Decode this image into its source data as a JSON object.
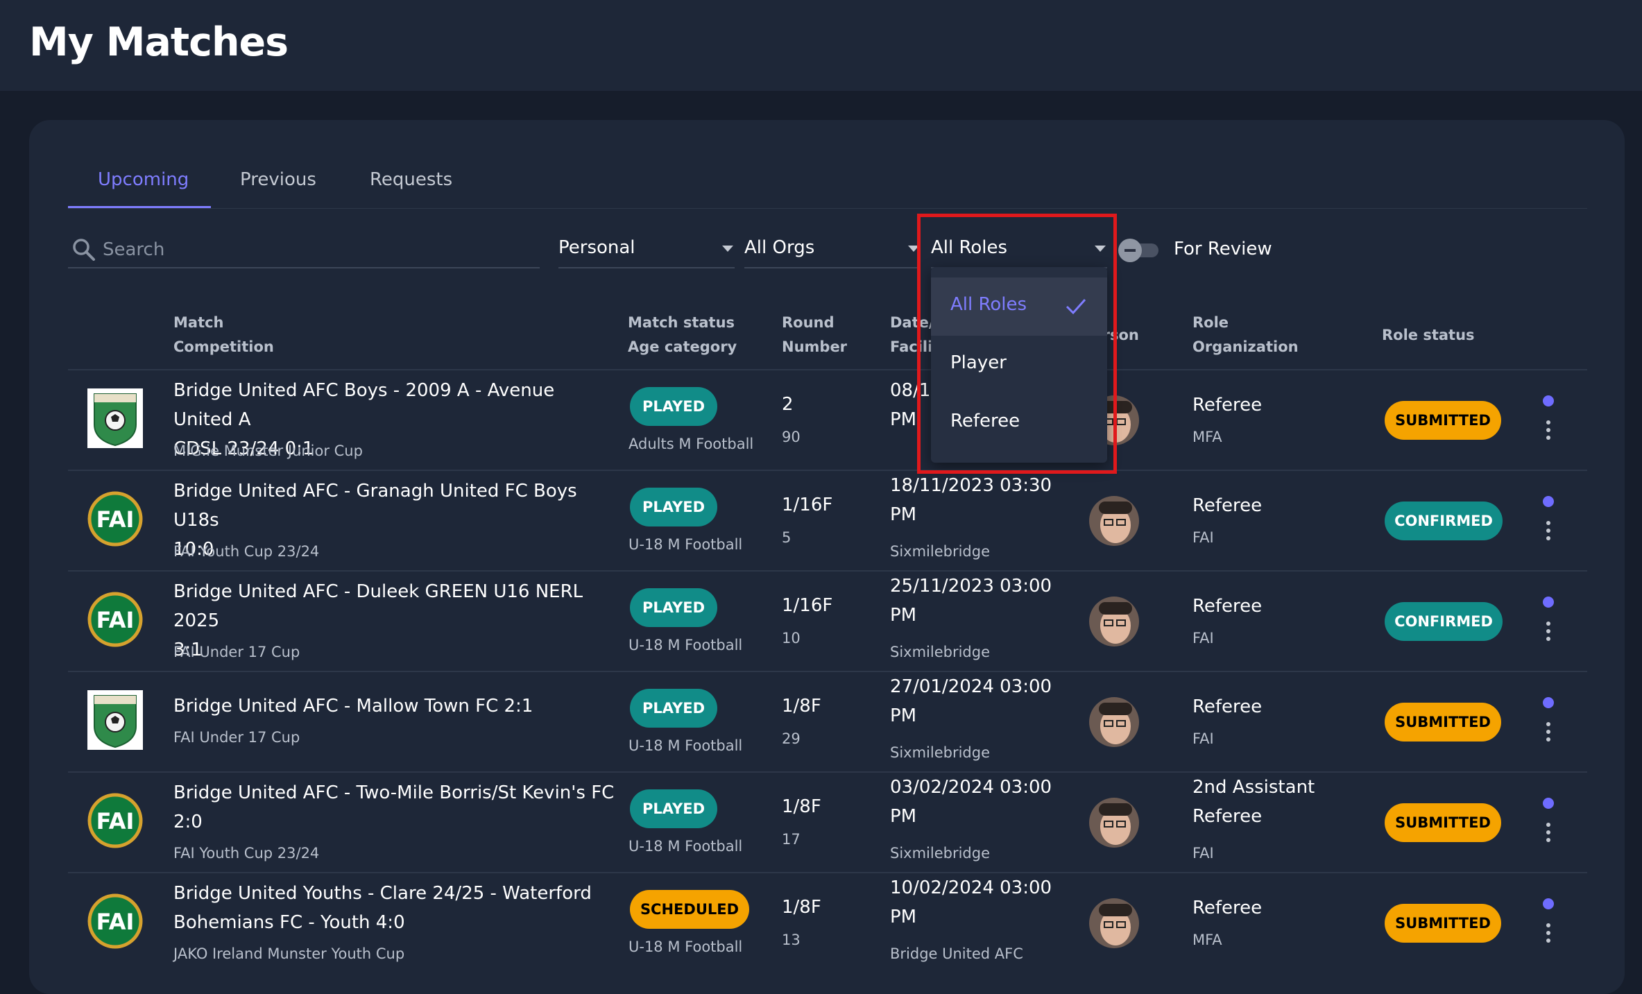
{
  "page": {
    "title": "My Matches"
  },
  "tabs": [
    {
      "label": "Upcoming",
      "active": true
    },
    {
      "label": "Previous",
      "active": false
    },
    {
      "label": "Requests",
      "active": false
    }
  ],
  "filters": {
    "search_placeholder": "Search",
    "scope": "Personal",
    "orgs": "All Orgs",
    "roles": "All Roles",
    "for_review_label": "For Review",
    "for_review_on": false
  },
  "dropdown": {
    "options": [
      {
        "label": "All Roles",
        "selected": true
      },
      {
        "label": "Player",
        "selected": false
      },
      {
        "label": "Referee",
        "selected": false
      }
    ]
  },
  "columns": {
    "match": "Match",
    "competition": "Competition",
    "match_status": "Match status",
    "age_category": "Age category",
    "round": "Round",
    "number": "Number",
    "date": "Date/",
    "facility": "Facility",
    "person": "Person",
    "role": "Role",
    "organization": "Organization",
    "role_status": "Role status"
  },
  "rows": [
    {
      "title_line1": "Bridge United AFC Boys - 2009 A - Avenue United A",
      "title_line2": "CDSL 23/24 0:1",
      "competition": "MIG.ie Munster Junior Cup",
      "status": "PLAYED",
      "age": "Adults M Football",
      "round": "2",
      "number": "90",
      "date_line1": "08/1",
      "date_line2": "PM",
      "facility": "",
      "role_line1": "Referee",
      "role_line2": "",
      "org": "MFA",
      "role_status": "SUBMITTED",
      "logo": "crest-logo"
    },
    {
      "title_line1": "Bridge United AFC - Granagh United FC Boys U18s",
      "title_line2": "10:0",
      "competition": "FAI Youth Cup 23/24",
      "status": "PLAYED",
      "age": "U-18 M Football",
      "round": "1/16F",
      "number": "5",
      "date_line1": "18/11/2023 03:30",
      "date_line2": "PM",
      "facility": "Sixmilebridge",
      "role_line1": "Referee",
      "role_line2": "",
      "org": "FAI",
      "role_status": "CONFIRMED",
      "logo": "fai-logo"
    },
    {
      "title_line1": "Bridge United AFC - Duleek GREEN U16 NERL 2025",
      "title_line2": "3:1",
      "competition": "FAI Under 17 Cup",
      "status": "PLAYED",
      "age": "U-18 M Football",
      "round": "1/16F",
      "number": "10",
      "date_line1": "25/11/2023 03:00",
      "date_line2": "PM",
      "facility": "Sixmilebridge",
      "role_line1": "Referee",
      "role_line2": "",
      "org": "FAI",
      "role_status": "CONFIRMED",
      "logo": "fai-logo"
    },
    {
      "title_line1": "Bridge United AFC - Mallow Town FC 2:1",
      "title_line2": "",
      "competition": "FAI Under 17 Cup",
      "status": "PLAYED",
      "age": "U-18 M Football",
      "round": "1/8F",
      "number": "29",
      "date_line1": "27/01/2024 03:00",
      "date_line2": "PM",
      "facility": "Sixmilebridge",
      "role_line1": "Referee",
      "role_line2": "",
      "org": "FAI",
      "role_status": "SUBMITTED",
      "logo": "crest-logo"
    },
    {
      "title_line1": "Bridge United AFC - Two-Mile Borris/St Kevin's FC",
      "title_line2": "2:0",
      "competition": "FAI Youth Cup 23/24",
      "status": "PLAYED",
      "age": "U-18 M Football",
      "round": "1/8F",
      "number": "17",
      "date_line1": "03/02/2024 03:00",
      "date_line2": "PM",
      "facility": "Sixmilebridge",
      "role_line1": "2nd Assistant",
      "role_line2": "Referee",
      "org": "FAI",
      "role_status": "SUBMITTED",
      "logo": "fai-logo"
    },
    {
      "title_line1": "Bridge United Youths - Clare 24/25 - Waterford",
      "title_line2": "Bohemians FC - Youth 4:0",
      "competition": "JAKO Ireland Munster Youth Cup",
      "status": "SCHEDULED",
      "age": "U-18 M Football",
      "round": "1/8F",
      "number": "13",
      "date_line1": "10/02/2024 03:00",
      "date_line2": "PM",
      "facility": "Bridge United AFC",
      "role_line1": "Referee",
      "role_line2": "",
      "org": "MFA",
      "role_status": "SUBMITTED",
      "logo": "fai-logo"
    }
  ],
  "fai_logo_text": "FAI",
  "colors": {
    "accent": "#7f7dff",
    "played": "#118c88",
    "submitted": "#f5a300",
    "highlight": "#e0191c"
  }
}
